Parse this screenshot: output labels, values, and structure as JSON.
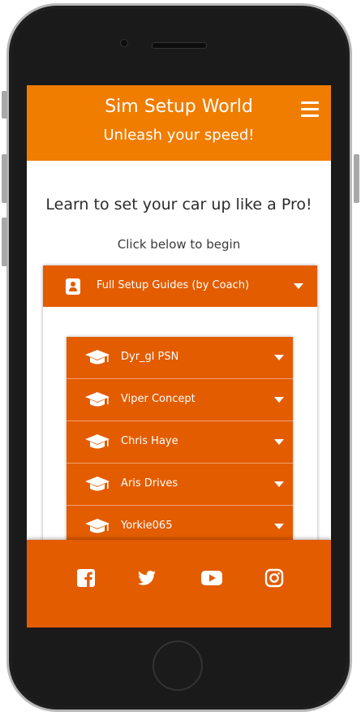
{
  "header": {
    "title": "Sim Setup World",
    "tagline": "Unleash your speed!"
  },
  "intro": {
    "headline": "Learn to set your car up like a Pro!",
    "subline": "Click below to begin"
  },
  "accordion": {
    "title": "Full Setup Guides (by Coach)",
    "coaches": [
      {
        "name": "Dyr_gl PSN"
      },
      {
        "name": "Viper Concept"
      },
      {
        "name": "Chris Haye"
      },
      {
        "name": "Aris Drives"
      },
      {
        "name": "Yorkie065"
      }
    ]
  },
  "footer": {
    "social_icons": [
      "facebook-icon",
      "twitter-icon",
      "youtube-icon",
      "instagram-icon"
    ]
  },
  "colors": {
    "header_bg": "#f07d00",
    "accent": "#e35c00",
    "text_on_accent": "#ffffff"
  }
}
